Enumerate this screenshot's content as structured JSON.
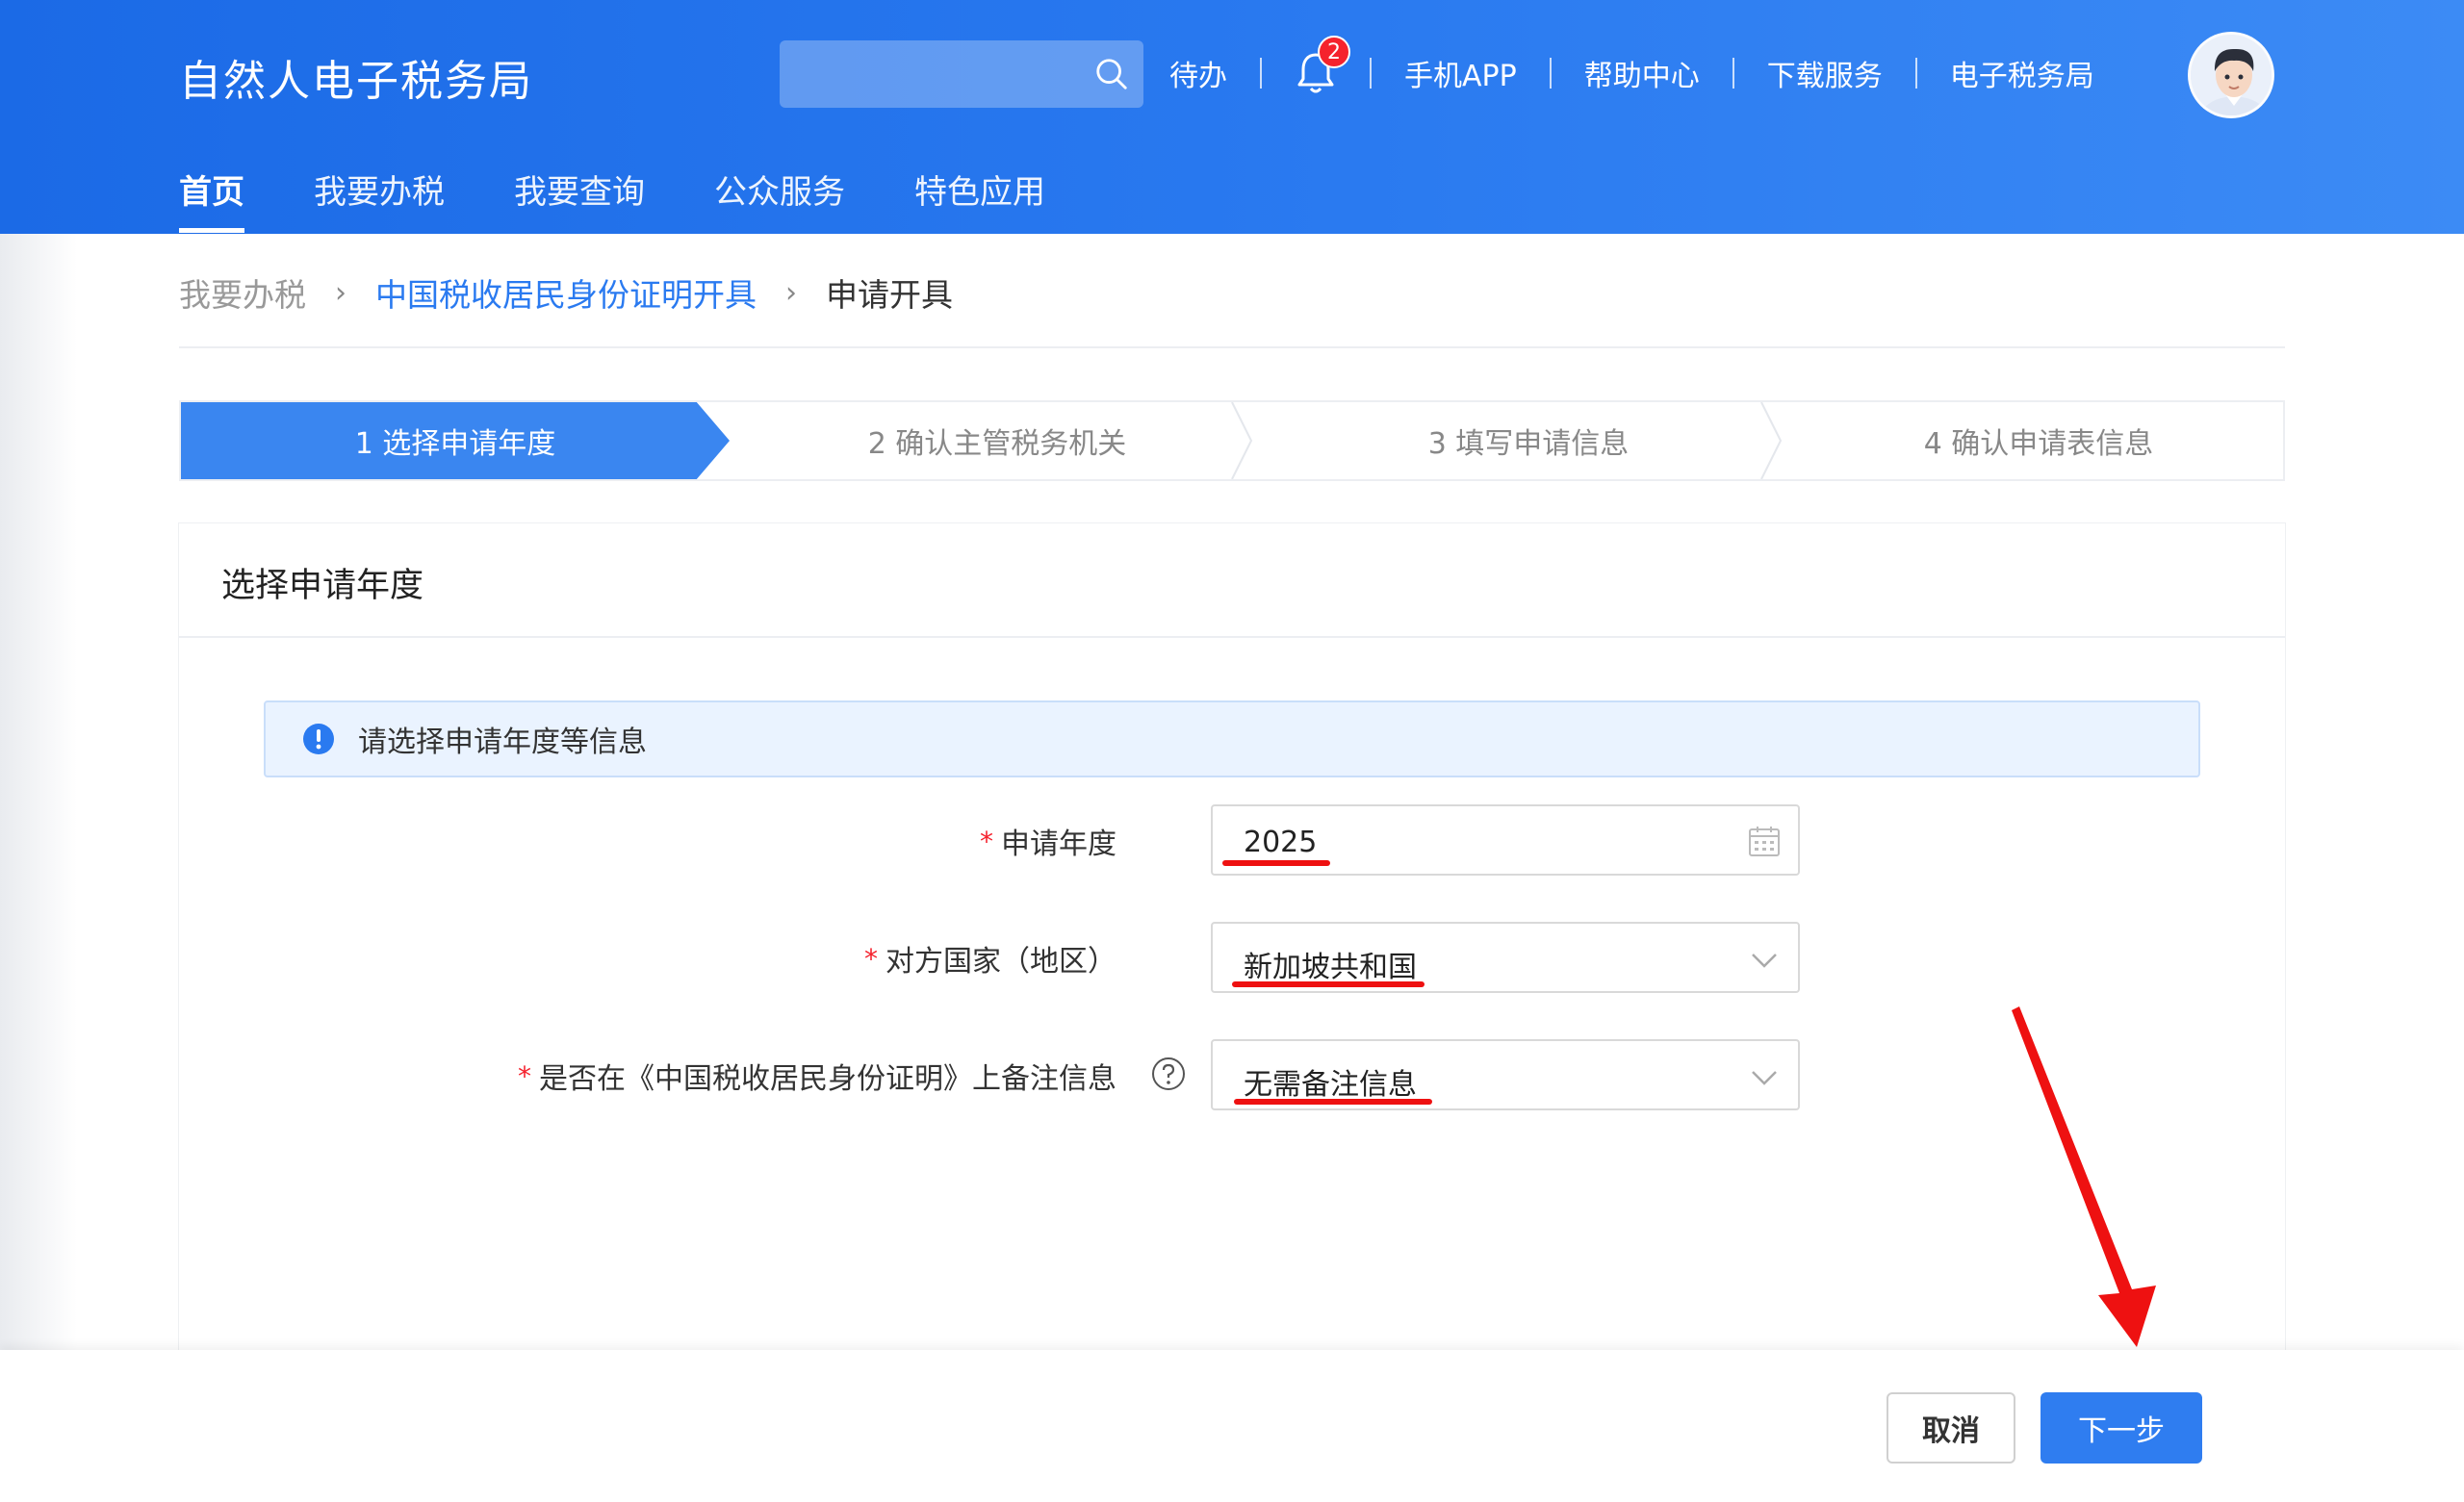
{
  "header": {
    "logo": "自然人电子税务局",
    "search_placeholder": "",
    "links": {
      "todo": "待办",
      "mobile_app": "手机APP",
      "help": "帮助中心",
      "download": "下载服务",
      "etax": "电子税务局"
    },
    "notification_count": "2",
    "main_nav": [
      "首页",
      "我要办税",
      "我要查询",
      "公众服务",
      "特色应用"
    ],
    "active_nav": "首页"
  },
  "breadcrumb": [
    "我要办税",
    "中国税收居民身份证明开具",
    "申请开具"
  ],
  "steps": [
    {
      "label": "1  选择申请年度",
      "active": true
    },
    {
      "label": "2  确认主管税务机关",
      "active": false
    },
    {
      "label": "3  填写申请信息",
      "active": false
    },
    {
      "label": "4  确认申请表信息",
      "active": false
    }
  ],
  "card": {
    "title": "选择申请年度",
    "notice": "请选择申请年度等信息"
  },
  "form": {
    "year": {
      "label": "申请年度",
      "value": "2025"
    },
    "country": {
      "label": "对方国家（地区）",
      "value": "新加坡共和国"
    },
    "remark": {
      "label": "是否在《中国税收居民身份证明》上备注信息",
      "value": "无需备注信息"
    }
  },
  "footer": {
    "cancel": "取消",
    "next": "下一步"
  },
  "colors": {
    "primary": "#2a7af0",
    "annotation_red": "#ee1111"
  }
}
